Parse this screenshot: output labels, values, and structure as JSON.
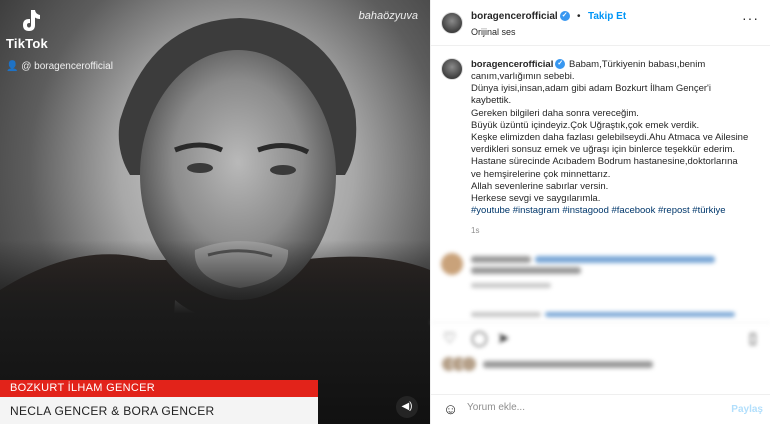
{
  "video": {
    "tiktok_word": "TikTok",
    "tiktok_user": "@ boragencerofficial",
    "watermark": "bahaözyuva",
    "lower_third_name": "BOZKURT İLHAM GENCER",
    "lower_third_credit": "NECLA GENCER & BORA GENCER",
    "icons": {
      "tiktok": "tiktok-logo-icon",
      "user": "user-icon",
      "mute": "speaker-icon"
    }
  },
  "header": {
    "username": "boragencerofficial",
    "separator": "•",
    "follow_label": "Takip Et",
    "audio_label": "Orijinal ses",
    "more_label": "···"
  },
  "caption": {
    "username": "boragencerofficial",
    "first_line": "Babam,Türkiyenin babası,benim",
    "lines": [
      "canım,varlığımın sebebi.",
      "Dünya iyisi,insan,adam gibi adam Bozkurt İlham Gençer'i",
      "kaybettik.",
      "Gereken bilgileri daha sonra vereceğim.",
      "Büyük üzüntü içindeyiz.Çok Uğraştık,çok emek verdik.",
      "Keşke elimizden daha fazlası gelebilseydi.Ahu Atmaca ve Ailesine",
      "verdikleri sonsuz emek ve uğraşı için binlerce teşekkür ederim.",
      "Hastane sürecinde Acıbadem Bodrum hastanesine,doktorlarına",
      "ve hemşirelerine çok minnettarız.",
      "Allah sevenlerine sabırlar versin.",
      "Herkese sevgi ve saygılarımla."
    ],
    "hashtags": "#youtube #instagram #instagood #facebook #repost #türkiye",
    "time": "1s"
  },
  "actions": {
    "icons": [
      "heart-icon",
      "comment-icon",
      "share-icon",
      "bookmark-icon"
    ]
  },
  "comment_box": {
    "emoji_icon": "smiley-icon",
    "placeholder": "Yorum ekle...",
    "share_label": "Paylaş"
  }
}
